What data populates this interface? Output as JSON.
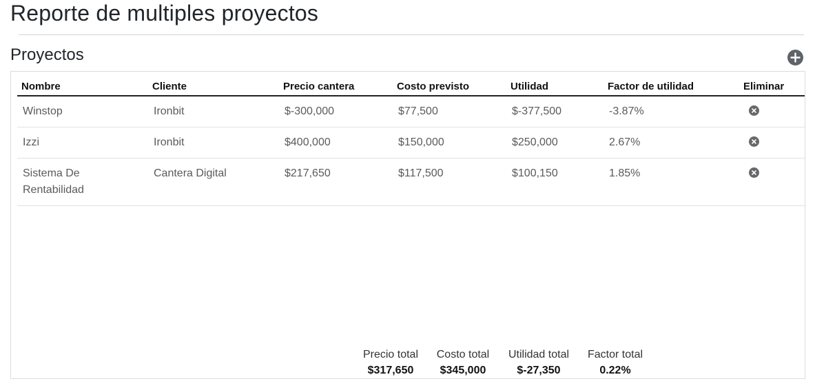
{
  "page": {
    "title": "Reporte de multiples proyectos"
  },
  "section": {
    "title": "Proyectos",
    "add_icon": "plus-circle-icon"
  },
  "table": {
    "headers": {
      "nombre": "Nombre",
      "cliente": "Cliente",
      "precio": "Precio cantera",
      "costo": "Costo previsto",
      "utilidad": "Utilidad",
      "factor": "Factor de utilidad",
      "eliminar": "Eliminar"
    },
    "rows": [
      {
        "nombre": "Winstop",
        "cliente": "Ironbit",
        "precio": "$-300,000",
        "costo": "$77,500",
        "utilidad": "$-377,500",
        "factor": "-3.87%"
      },
      {
        "nombre": "Izzi",
        "cliente": "Ironbit",
        "precio": "$400,000",
        "costo": "$150,000",
        "utilidad": "$250,000",
        "factor": "2.67%"
      },
      {
        "nombre": "Sistema De Rentabilidad",
        "cliente": "Cantera Digital",
        "precio": "$217,650",
        "costo": "$117,500",
        "utilidad": "$100,150",
        "factor": "1.85%"
      }
    ],
    "delete_icon": "x-circle-icon"
  },
  "totals": {
    "precio": {
      "label": "Precio total",
      "value": "$317,650"
    },
    "costo": {
      "label": "Costo total",
      "value": "$345,000"
    },
    "utilidad": {
      "label": "Utilidad total",
      "value": "$-27,350"
    },
    "factor": {
      "label": "Factor total",
      "value": "0.22%"
    }
  },
  "colors": {
    "icon_gray": "#5f6368",
    "text_muted": "#5a5a5a",
    "border": "#dcdcdc"
  }
}
